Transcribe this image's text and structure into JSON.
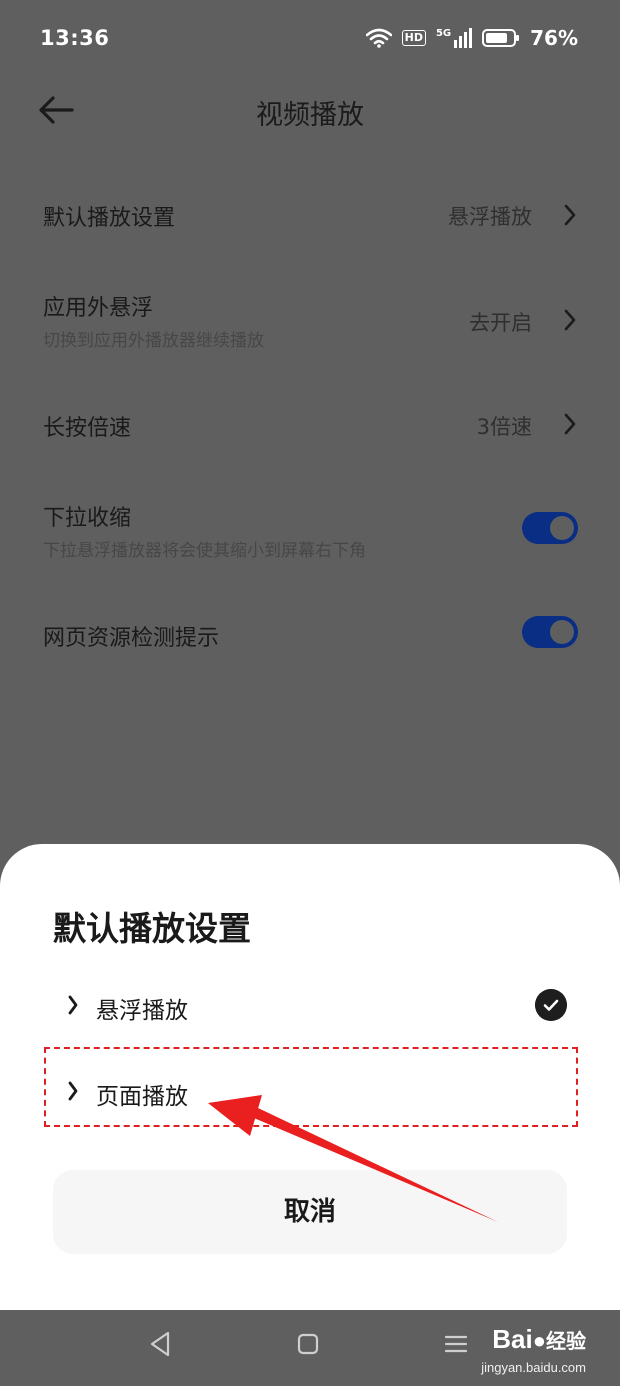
{
  "status_bar": {
    "time": "13:36",
    "network": "5G",
    "hd_badge": "HD",
    "battery": "76%"
  },
  "header": {
    "title": "视频播放",
    "back_icon": "arrow-left-icon"
  },
  "settings": [
    {
      "label": "默认播放设置",
      "value": "悬浮播放"
    },
    {
      "label": "应用外悬浮",
      "subtitle": "切换到应用外播放器继续播放",
      "value": "去开启"
    },
    {
      "label": "长按倍速",
      "value": "3倍速"
    },
    {
      "label": "下拉收缩",
      "subtitle": "下拉悬浮播放器将会使其缩小到屏幕右下角",
      "toggle_on": true
    },
    {
      "label": "网页资源检测提示",
      "toggle_on": true
    }
  ],
  "sheet": {
    "title": "默认播放设置",
    "options": [
      {
        "label": "悬浮播放",
        "selected": true
      },
      {
        "label": "页面播放",
        "selected": false
      }
    ],
    "cancel_label": "取消"
  },
  "watermark": {
    "brand": "Bai",
    "brand_suffix": "经验",
    "url": "jingyan.baidu.com"
  },
  "colors": {
    "toggle_on": "#0a2e84",
    "annotation_red": "#e02020",
    "overlay": "#5f5f5f"
  }
}
